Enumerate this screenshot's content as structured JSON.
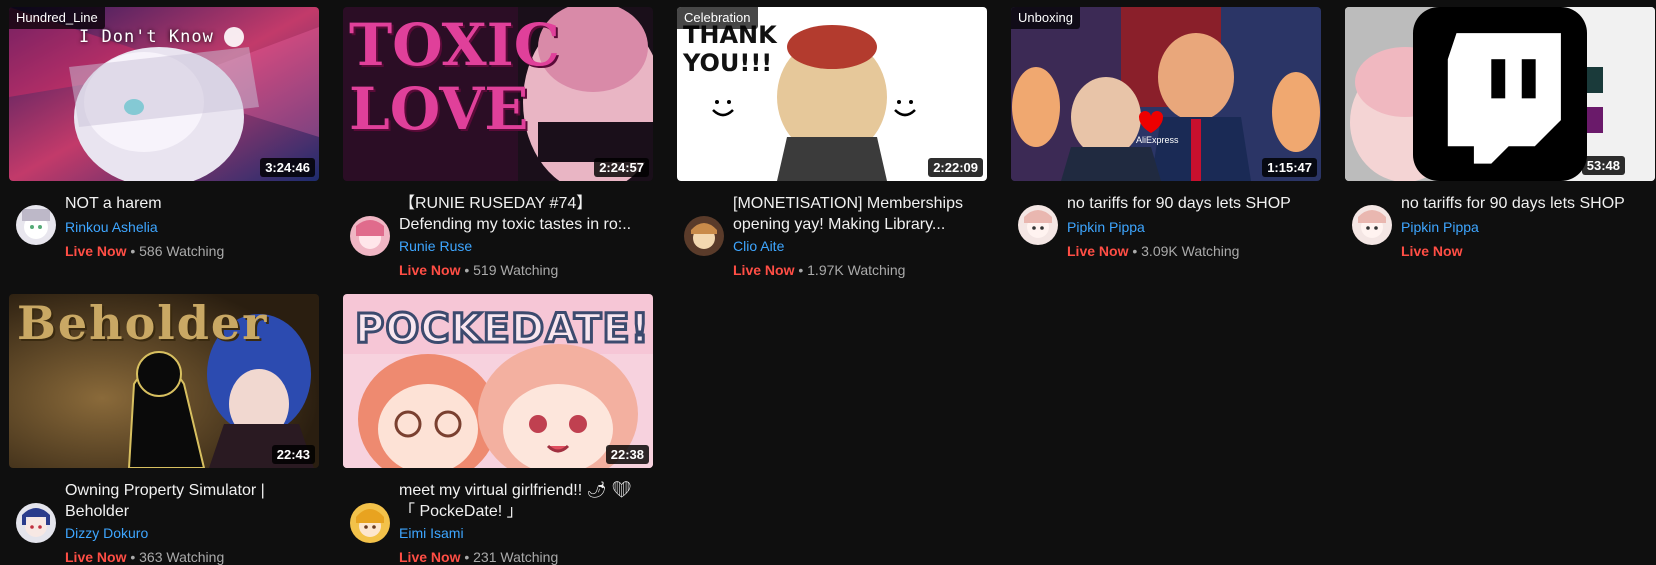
{
  "cards": [
    {
      "tag": "Hundred_Line",
      "thumb_text": "I Don't Know",
      "duration": "3:24:46",
      "title": "NOT a harem",
      "channel": "Rinkou Ashelia",
      "live": "Live Now",
      "watching": " • 586 Watching"
    },
    {
      "tag": "",
      "thumb_text": "TOXIC LOVE",
      "duration": "2:24:57",
      "title": "【RUNIE RUSEDAY #74】 Defending my toxic tastes in ro:..",
      "channel": "Runie Ruse",
      "live": "Live Now",
      "watching": " • 519 Watching"
    },
    {
      "tag": "Celebration",
      "thumb_text": "THANK YOU!!!",
      "duration": "2:22:09",
      "title": "[MONETISATION] Memberships opening yay! Making Library...",
      "channel": "Clio Aite",
      "live": "Live Now",
      "watching": " • 1.97K Watching"
    },
    {
      "tag": "Unboxing",
      "thumb_text": "AliExpress",
      "duration": "1:15:47",
      "title": "no tariffs for 90 days lets SHOP",
      "channel": "Pipkin Pippa",
      "live": "Live Now",
      "watching": " • 3.09K Watching"
    },
    {
      "tag": "",
      "thumb_text": "",
      "duration": "53:48",
      "title": "no tariffs for 90 days lets SHOP",
      "channel": "Pipkin Pippa",
      "live": "Live Now",
      "watching": ""
    },
    {
      "tag": "",
      "thumb_text": "Beholder",
      "duration": "22:43",
      "title": "Owning Property Simulator | Beholder",
      "channel": "Dizzy Dokuro",
      "live": "Live Now",
      "watching": " • 363 Watching"
    },
    {
      "tag": "",
      "thumb_text": "POCKEDATE!",
      "duration": "22:38",
      "title": "meet my virtual girlfriend!! 🌶 ❤ 「 PockeDate! 」",
      "channel": "Eimi Isami",
      "live": "Live Now",
      "watching": " • 231 Watching"
    }
  ],
  "colors": {
    "background": "#0f0f0f",
    "channel": "#3ea6ff",
    "live": "#ff4e45",
    "meta": "#aaaaaa",
    "twitch": "#9146ff"
  }
}
